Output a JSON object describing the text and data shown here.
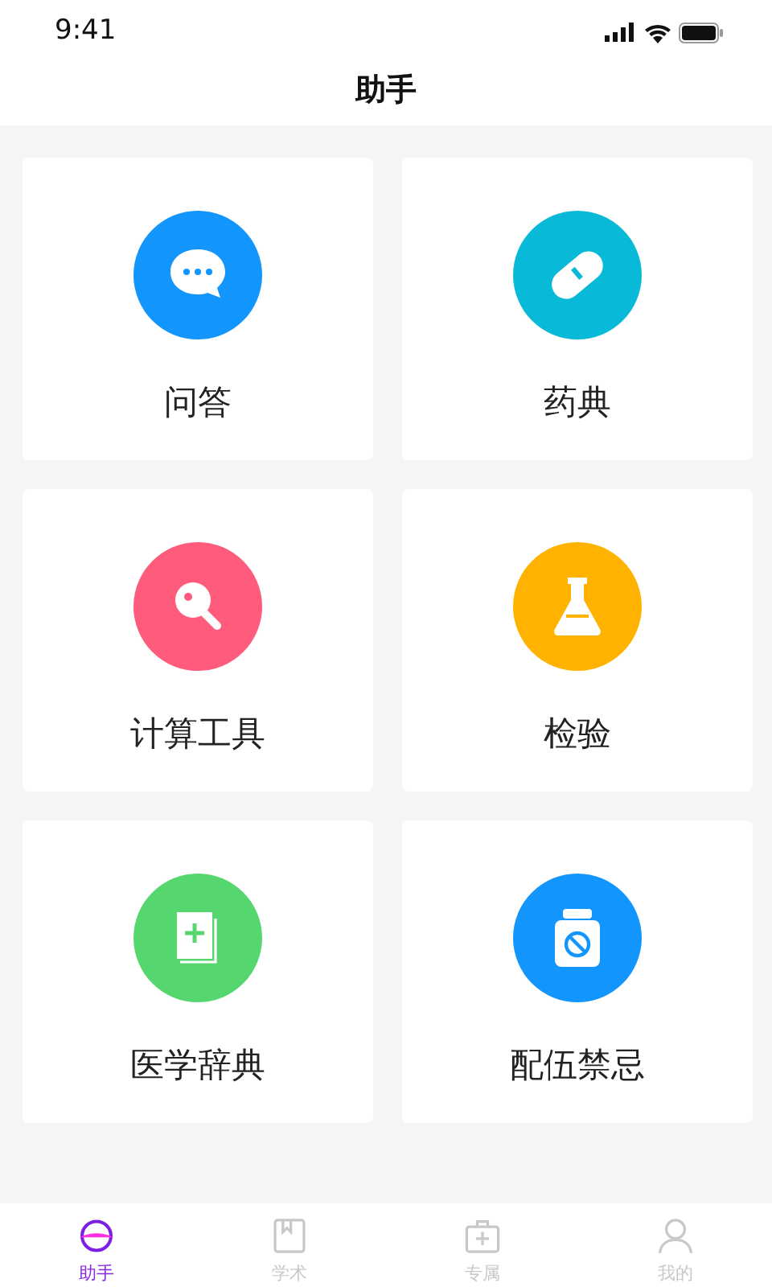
{
  "status_bar": {
    "time": "9:41"
  },
  "header": {
    "title": "助手"
  },
  "tools": [
    {
      "label": "问答",
      "color": "#1296fe"
    },
    {
      "label": "药典",
      "color": "#09bad8"
    },
    {
      "label": "计算工具",
      "color": "#fe5b7d"
    },
    {
      "label": "检验",
      "color": "#ffb300"
    },
    {
      "label": "医学辞典",
      "color": "#55d66f"
    },
    {
      "label": "配伍禁忌",
      "color": "#1296fe"
    }
  ],
  "tab_bar": [
    {
      "label": "助手",
      "selected": true
    },
    {
      "label": "学术",
      "selected": false
    },
    {
      "label": "专属",
      "selected": false
    },
    {
      "label": "我的",
      "selected": false
    }
  ]
}
